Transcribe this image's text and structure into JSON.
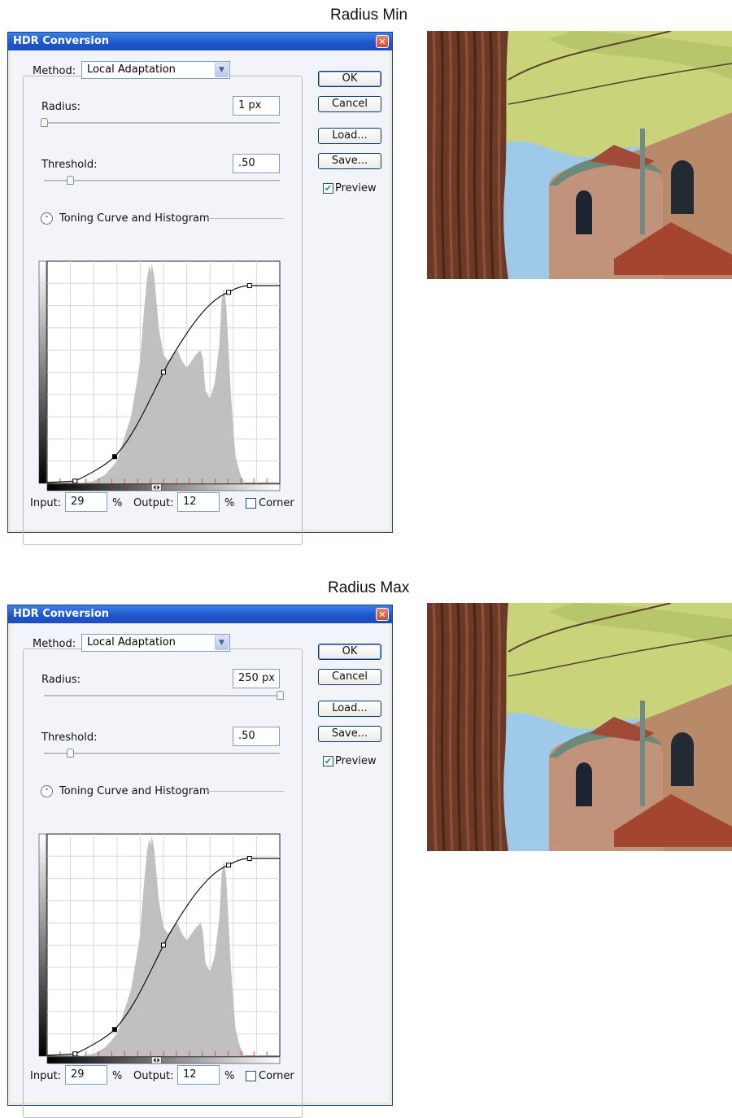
{
  "panels": [
    {
      "caption": "Radius Min",
      "dialog": {
        "title": "HDR Conversion",
        "method_label": "Method:",
        "method_value": "Local Adaptation",
        "radius_label": "Radius:",
        "radius_value": "1 px",
        "radius_slider_fraction": 0.0,
        "threshold_label": "Threshold:",
        "threshold_value": ".50",
        "threshold_slider_fraction": 0.11,
        "toning_label": "Toning Curve and Histogram",
        "input_label": "Input:",
        "input_value": "29",
        "input_unit": "%",
        "output_label": "Output:",
        "output_value": "12",
        "output_unit": "%",
        "corner_label": "Corner",
        "ok_label": "OK",
        "cancel_label": "Cancel",
        "load_label": "Load...",
        "save_label": "Save...",
        "preview_label": "Preview"
      }
    },
    {
      "caption": "Radius Max",
      "dialog": {
        "title": "HDR Conversion",
        "method_label": "Method:",
        "method_value": "Local Adaptation",
        "radius_label": "Radius:",
        "radius_value": "250 px",
        "radius_slider_fraction": 1.0,
        "threshold_label": "Threshold:",
        "threshold_value": ".50",
        "threshold_slider_fraction": 0.11,
        "toning_label": "Toning Curve and Histogram",
        "input_label": "Input:",
        "input_value": "29",
        "input_unit": "%",
        "output_label": "Output:",
        "output_value": "12",
        "output_unit": "%",
        "corner_label": "Corner",
        "ok_label": "OK",
        "cancel_label": "Cancel",
        "load_label": "Load...",
        "save_label": "Save...",
        "preview_label": "Preview"
      }
    }
  ],
  "colors": {
    "titlebar": "#1e55c9",
    "dialog_bg": "#f2f4fa",
    "histogram": "#c0c0c0",
    "tick_marks": "#e05020"
  },
  "icons": {
    "close": "close-icon",
    "dropdown": "chevron-down-icon",
    "collapse": "double-chevron-up-icon",
    "check": "checkmark-icon"
  }
}
